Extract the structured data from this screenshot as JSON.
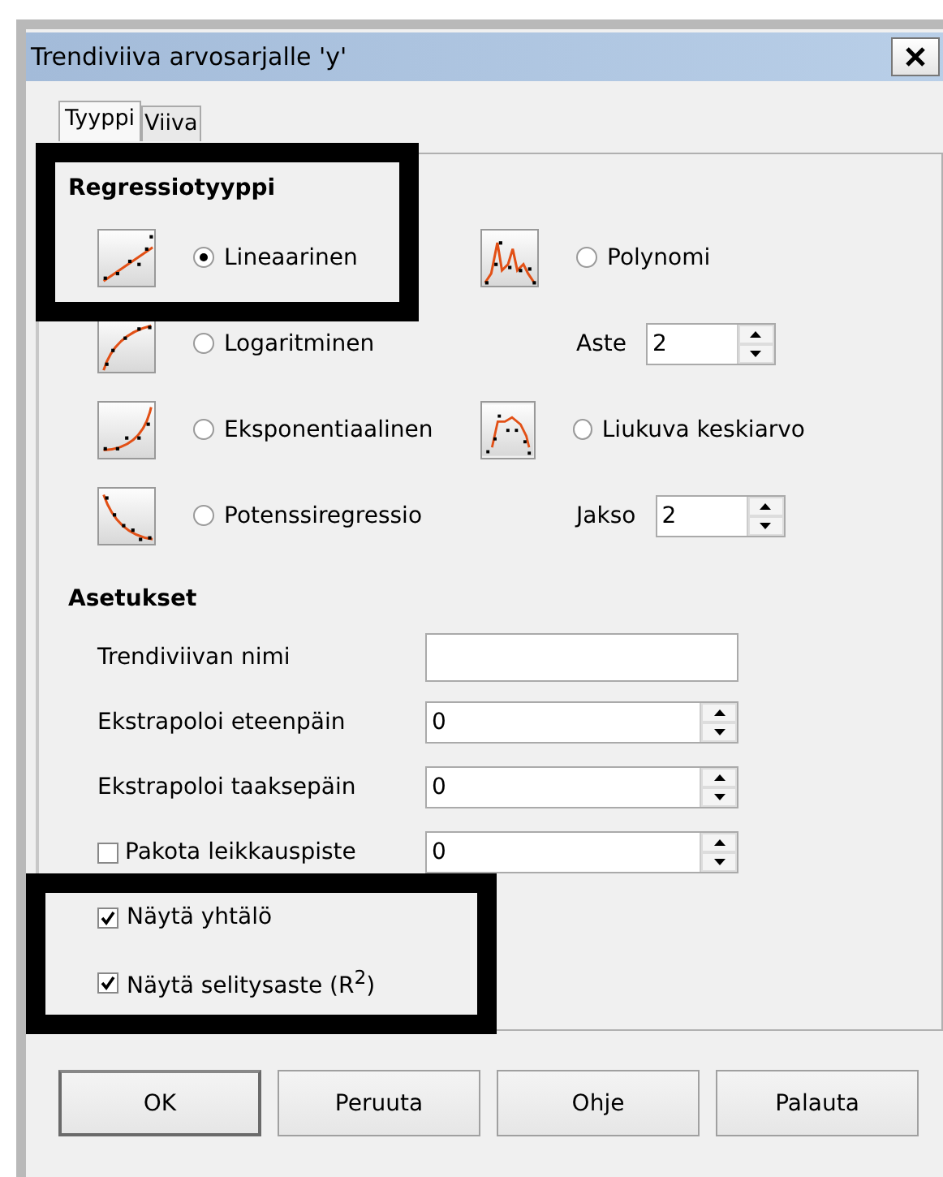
{
  "window": {
    "title": "Trendiviiva arvosarjalle 'y'"
  },
  "tabs": [
    {
      "label": "Tyyppi",
      "selected": true
    },
    {
      "label": "Viiva",
      "selected": false
    }
  ],
  "regression": {
    "heading": "Regressiotyyppi",
    "types": [
      {
        "label": "Lineaarinen",
        "kind": "linear",
        "selected": true
      },
      {
        "label": "Logaritminen",
        "kind": "log",
        "selected": false
      },
      {
        "label": "Eksponentiaalinen",
        "kind": "exp",
        "selected": false
      },
      {
        "label": "Potenssiregressio",
        "kind": "power",
        "selected": false
      }
    ],
    "other_types": [
      {
        "label": "Polynomi",
        "kind": "poly",
        "selected": false,
        "param": {
          "label": "Aste",
          "value": "2"
        }
      },
      {
        "label": "Liukuva keskiarvo",
        "kind": "moving",
        "selected": false,
        "param": {
          "label": "Jakso",
          "value": "2"
        }
      }
    ]
  },
  "settings": {
    "heading": "Asetukset",
    "fields": [
      {
        "label": "Trendiviivan nimi",
        "kind": "text"
      },
      {
        "label": "Ekstrapoloi eteenpäin",
        "kind": "spin",
        "value": "0"
      },
      {
        "label": "Ekstrapoloi taaksepäin",
        "kind": "spin",
        "value": "0"
      },
      {
        "label": "Pakota leikkauspiste",
        "kind": "check-spin",
        "checked": false,
        "value": "0"
      }
    ],
    "checks": [
      {
        "label": "Näytä yhtälö",
        "checked": true
      },
      {
        "label": "Näytä selitysaste (R$^{2}$)",
        "checked": true
      }
    ]
  },
  "buttons": [
    {
      "label": "OK",
      "default": true
    },
    {
      "label": "Peruuta",
      "default": false
    },
    {
      "label": "Ohje",
      "default": false
    },
    {
      "label": "Palauta",
      "default": false
    }
  ]
}
